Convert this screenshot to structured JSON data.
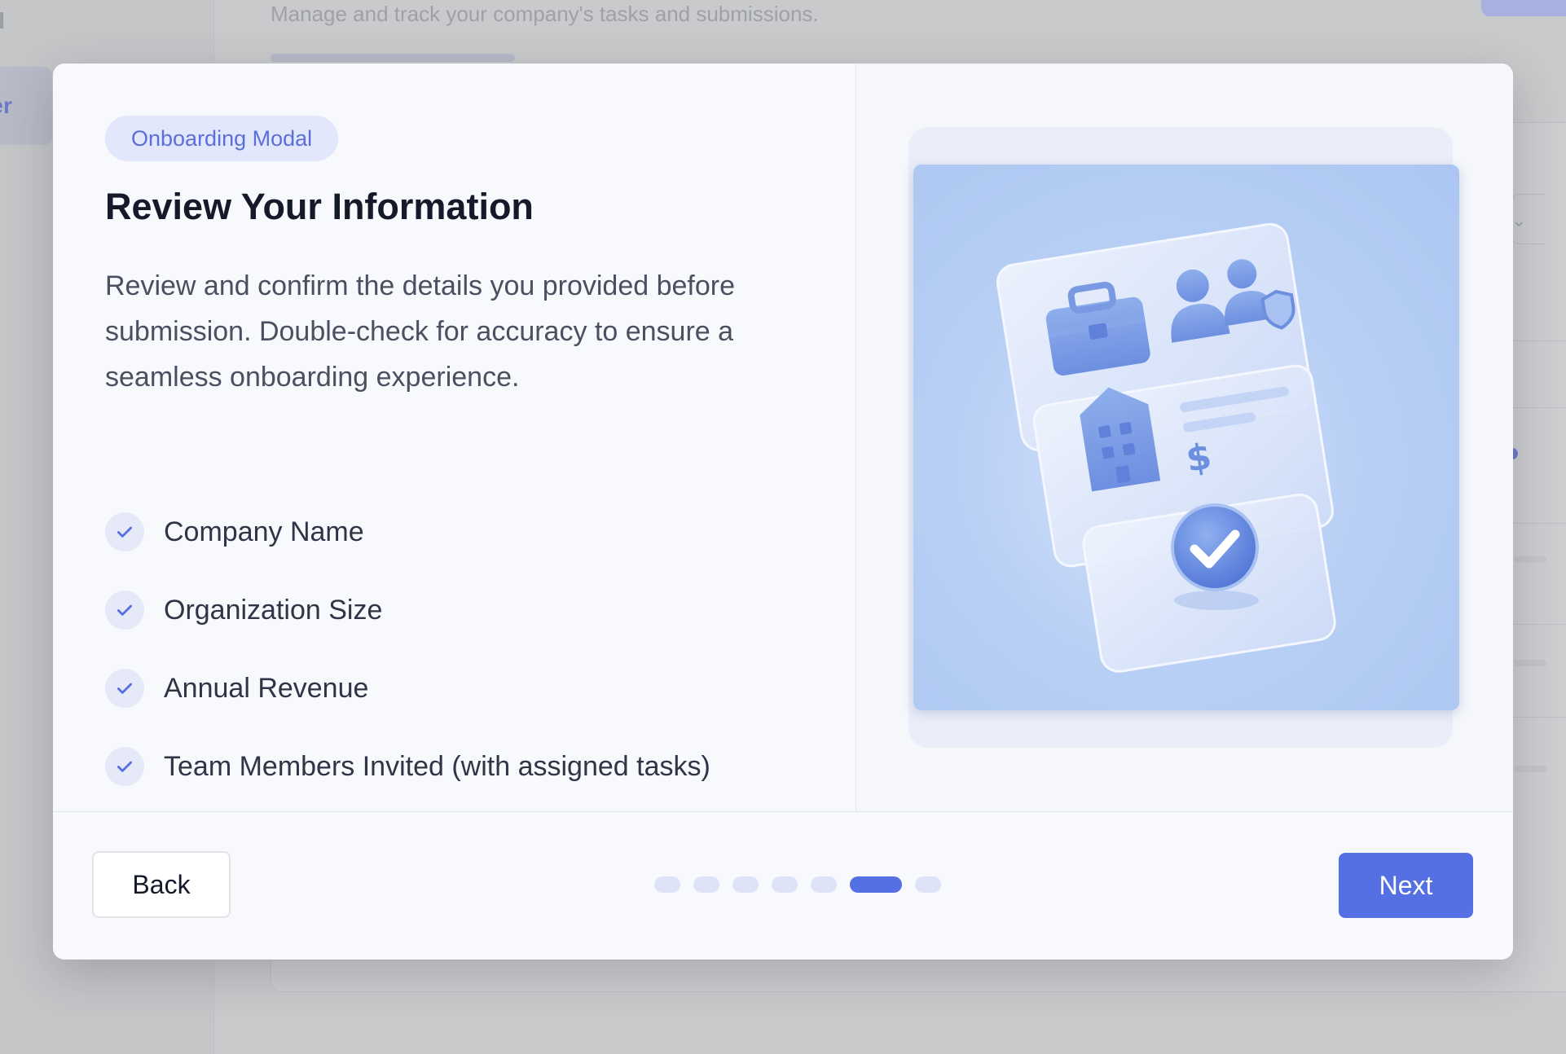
{
  "background": {
    "nav_first_label": "rd",
    "nav_active_label": "nter",
    "nav_third_label": "l",
    "subtitle": "Manage and track your company's tasks and submissions."
  },
  "modal": {
    "badge": "Onboarding Modal",
    "title": "Review Your Information",
    "description": "Review and confirm the details you provided before submission. Double-check for accuracy to ensure a seamless onboarding experience.",
    "checklist": [
      {
        "label": "Company Name",
        "icon": "check-icon"
      },
      {
        "label": "Organization Size",
        "icon": "check-icon"
      },
      {
        "label": "Annual Revenue",
        "icon": "check-icon"
      },
      {
        "label": "Team Members Invited (with assigned tasks)",
        "icon": "check-icon"
      }
    ],
    "illustration": {
      "icons": [
        "briefcase-icon",
        "team-shield-icon",
        "building-icon",
        "dollar-icon",
        "checkmark-badge-icon"
      ],
      "currency_symbol": "$"
    }
  },
  "footer": {
    "back_label": "Back",
    "next_label": "Next",
    "steps_total": 7,
    "current_step": 6
  },
  "colors": {
    "accent": "#5570e2",
    "badge_bg": "#e3e7fb",
    "badge_text": "#5a6fd9",
    "title": "#151a2b",
    "body_text": "#4a5061",
    "overlay": "#c9cacb",
    "illustration_bg": "#b9d0f5"
  }
}
